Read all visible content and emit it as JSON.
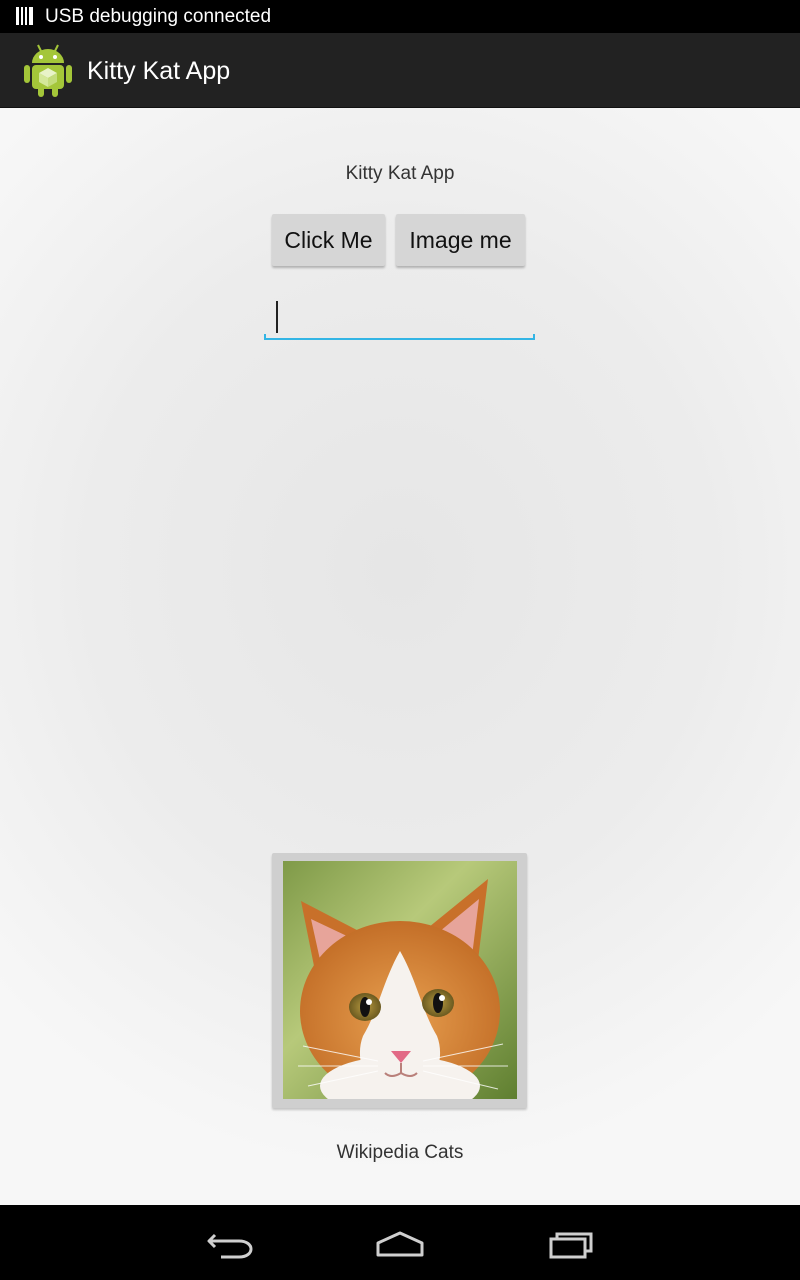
{
  "status_bar": {
    "notification_text": "USB debugging connected",
    "icon": "usb-debug-icon"
  },
  "action_bar": {
    "app_title": "Kitty Kat App",
    "icon": "android-robot-icon"
  },
  "main": {
    "heading": "Kitty Kat App",
    "buttons": {
      "click_me": "Click Me",
      "image_me": "Image me"
    },
    "text_input": {
      "value": "",
      "placeholder": ""
    },
    "image": {
      "description_icon": "kitten-photo",
      "caption": "Wikipedia Cats"
    }
  },
  "nav_bar": {
    "back_icon": "back-icon",
    "home_icon": "home-icon",
    "recents_icon": "recent-apps-icon"
  },
  "colors": {
    "accent": "#33b5e5",
    "action_bar": "#222222",
    "button": "#d6d6d6",
    "android_green": "#a4c639"
  }
}
